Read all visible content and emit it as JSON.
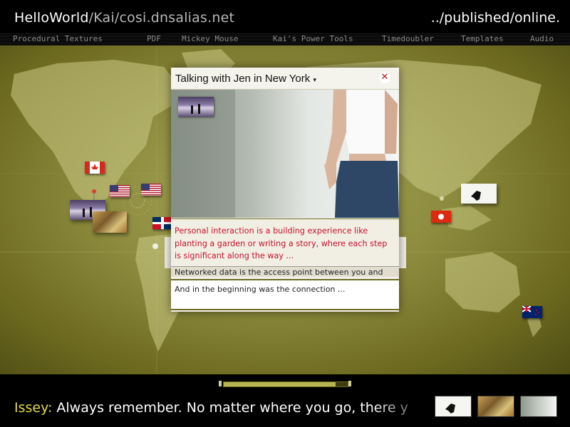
{
  "header": {
    "site_name": "HelloWorld",
    "site_path": "/Kai/cosi.dnsalias.net",
    "right_title": "../published/online."
  },
  "nav": {
    "items": [
      {
        "label": "Procedural Textures"
      },
      {
        "label": "PDF"
      },
      {
        "label": "Mickey Mouse"
      },
      {
        "label": "Kai's Power Tools"
      },
      {
        "label": "Timedoubler"
      },
      {
        "label": "Templates"
      },
      {
        "label": "Audio"
      }
    ]
  },
  "map": {
    "flags": [
      {
        "name": "canada",
        "icon": "canada-flag-icon"
      },
      {
        "name": "usa",
        "icon": "usa-flag-icon"
      },
      {
        "name": "usa",
        "icon": "usa-flag-icon"
      },
      {
        "name": "dominican-republic",
        "icon": "dominican-republic-flag-icon"
      },
      {
        "name": "hong-kong",
        "icon": "hong-kong-flag-icon"
      },
      {
        "name": "new-zealand",
        "icon": "new-zealand-flag-icon"
      }
    ]
  },
  "popup": {
    "title": "Talking with Jen in New York",
    "caret": "▾",
    "close": "✕",
    "red_text": "Personal interaction is a building experience like planting a garden or writing a story, where each step is significant along the way ...",
    "black_text": "Networked data is the access point between you and",
    "input_text": "And in the beginning was the connection ..."
  },
  "footer": {
    "speaker": "Issey:",
    "message": "Always remember.  No matter where you go, there y",
    "progress": 0.9
  },
  "colors": {
    "accent_yellow": "#e1d94a",
    "popup_red": "#c8102e",
    "olive": "#8e8d3f"
  }
}
